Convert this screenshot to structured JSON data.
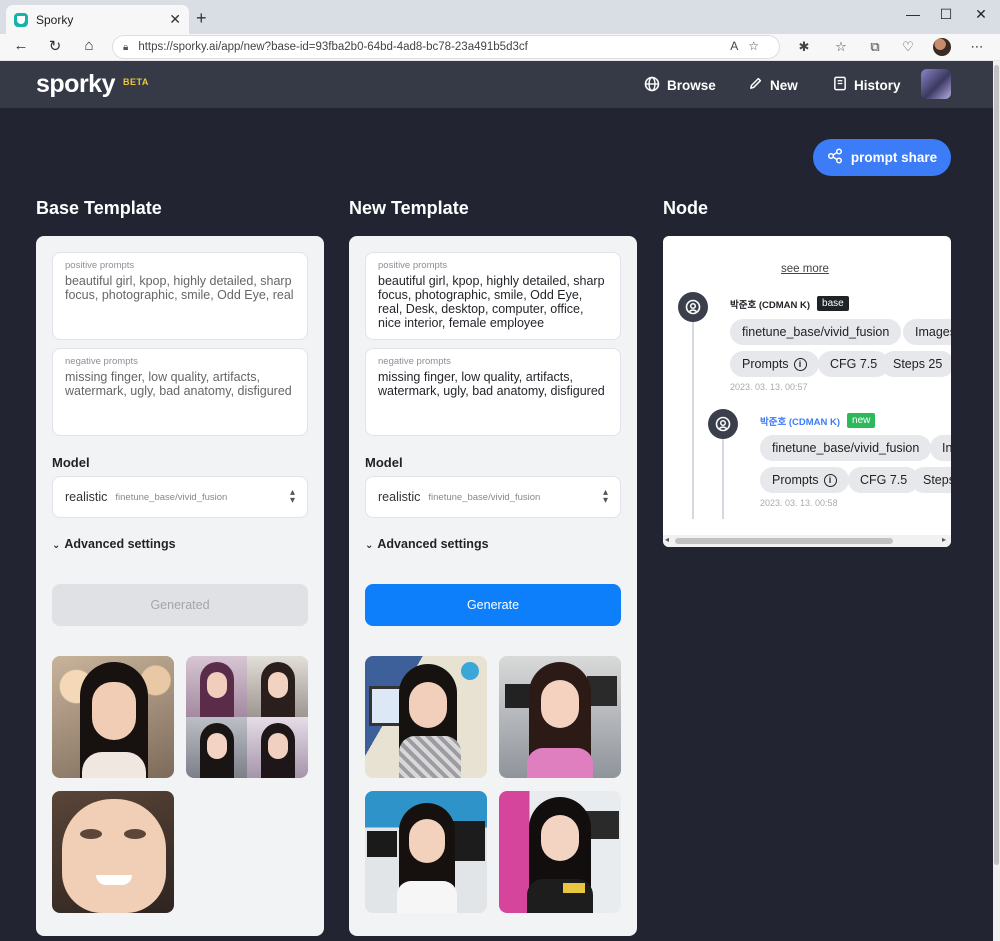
{
  "browser": {
    "tab_title": "Sporky",
    "tab_close": "✕",
    "new_tab": "+",
    "url": "https://sporky.ai/app/new?base-id=93fba2b0-64bd-4ad8-bc78-23a491b5d3cf",
    "window_controls": [
      "—",
      "☐",
      "✕"
    ]
  },
  "app": {
    "logo": "sporky",
    "beta": "BETA",
    "nav": [
      {
        "label": "Browse",
        "icon": "globe-icon"
      },
      {
        "label": "New",
        "icon": "pencil-icon"
      },
      {
        "label": "History",
        "icon": "book-icon"
      }
    ],
    "share_button": "prompt share",
    "colors": {
      "accent": "#3c7cf6",
      "generate": "#0d7ffb",
      "background": "#222531",
      "header": "#363a46",
      "base_tag": "#1f2227",
      "new_tag": "#2eb85c"
    }
  },
  "base_template": {
    "title": "Base Template",
    "positive_label": "positive prompts",
    "positive_text": "beautiful girl, kpop, highly detailed, sharp focus, photographic, smile, Odd Eye, real",
    "negative_label": "negative prompts",
    "negative_text": "missing finger, low quality, artifacts, watermark, ugly, bad anatomy, disfigured",
    "model_label": "Model",
    "model_value": "realistic",
    "model_sub": "finetune_base/vivid_fusion",
    "advanced": "Advanced settings",
    "button": "Generated"
  },
  "new_template": {
    "title": "New Template",
    "positive_label": "positive prompts",
    "positive_text": "beautiful girl, kpop, highly detailed, sharp focus, photographic, smile, Odd Eye, real, Desk, desktop, computer, office, nice interior, female employee",
    "negative_label": "negative prompts",
    "negative_text": "missing finger, low quality, artifacts, watermark, ugly, bad anatomy, disfigured",
    "model_label": "Model",
    "model_value": "realistic",
    "model_sub": "finetune_base/vivid_fusion",
    "advanced": "Advanced settings",
    "button": "Generate"
  },
  "node": {
    "title": "Node",
    "see_more": "see more",
    "entries": [
      {
        "user": "박준호 (CDMAN K)",
        "tag": "base",
        "chips": [
          "finetune_base/vivid_fusion",
          "Images",
          "Prompts",
          "CFG 7.5",
          "Steps 25"
        ],
        "date": "2023. 03. 13. 00:57"
      },
      {
        "user": "박준호 (CDMAN K)",
        "tag": "new",
        "chips": [
          "finetune_base/vivid_fusion",
          "In",
          "Prompts",
          "CFG 7.5",
          "Steps"
        ],
        "date": "2023. 03. 13. 00:58"
      }
    ]
  }
}
